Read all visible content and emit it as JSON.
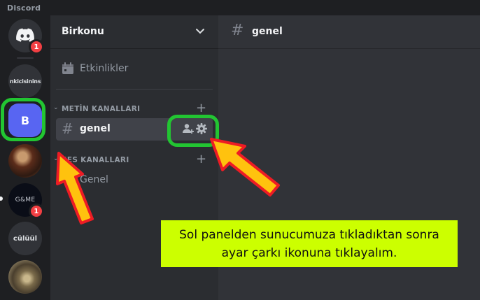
{
  "app": {
    "title": "Discord"
  },
  "rail": {
    "servers": [
      {
        "name": "home",
        "badge": "1"
      },
      {
        "name": "nk",
        "label": "nkicisinins"
      },
      {
        "name": "birkonu",
        "label": "B"
      },
      {
        "name": "photo1"
      },
      {
        "name": "game",
        "label": "G&ME",
        "badge": "1"
      },
      {
        "name": "culuul",
        "label": "cülüül"
      },
      {
        "name": "photo2"
      }
    ]
  },
  "sidebar": {
    "server_name": "Birkonu",
    "events_label": "Etkinlikler",
    "text_category": "METİN KANALLARI",
    "voice_category": "SES KANALLARI",
    "text_channels": [
      {
        "label": "genel"
      }
    ],
    "voice_channels": [
      {
        "label": "Genel"
      }
    ]
  },
  "main": {
    "channel_title": "genel"
  },
  "annotation": {
    "caption": "Sol panelden sunucumuza tıkladıktan sonra ayar çarkı ikonuna tıklayalım.",
    "highlight_color": "#22c532",
    "arrow_fill": "#ffc20e",
    "arrow_stroke": "#ee1c24",
    "caption_bg": "#ccff00"
  },
  "colors": {
    "accent": "#5865f2",
    "rail_bg": "#1e1f22",
    "sidebar_bg": "#2b2d31",
    "main_bg": "#313338",
    "badge": "#f23f43"
  }
}
